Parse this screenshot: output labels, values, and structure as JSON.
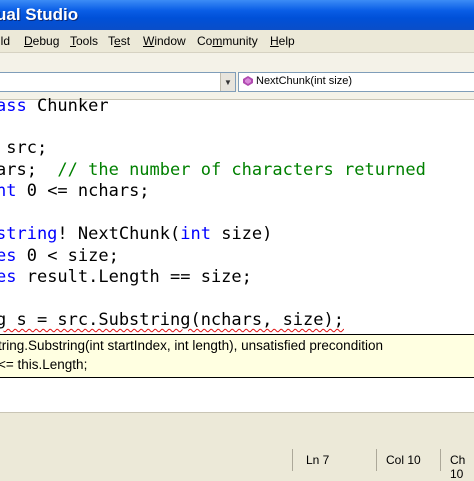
{
  "window": {
    "title": "ual Studio"
  },
  "menu": {
    "items": [
      {
        "pre": "",
        "u": "",
        "post": "ild"
      },
      {
        "pre": "",
        "u": "D",
        "post": "ebug"
      },
      {
        "pre": "",
        "u": "T",
        "post": "ools"
      },
      {
        "pre": "T",
        "u": "e",
        "post": "st"
      },
      {
        "pre": "",
        "u": "W",
        "post": "indow"
      },
      {
        "pre": "Co",
        "u": "m",
        "post": "munity"
      },
      {
        "pre": "",
        "u": "H",
        "post": "elp"
      }
    ]
  },
  "toolbar": {
    "member_dropdown": {
      "value": "NextChunk(int size)"
    }
  },
  "code": {
    "line1": {
      "kw": "ass",
      "rest": " Chunker"
    },
    "line2": {
      "text": " src;"
    },
    "line3": {
      "text": "ars;  ",
      "comment": "// the number of characters returned"
    },
    "line4": {
      "kw": "nt",
      "rest": " 0 <= nchars;"
    },
    "line5": {
      "kw1": "string",
      "mid": "! NextChunk(",
      "kw2": "int",
      "rest": " size)"
    },
    "line6": {
      "kw": "es",
      "rest": " 0 < size;"
    },
    "line7": {
      "kw": "es",
      "rest": " result.Length == size;"
    },
    "line8": {
      "text": "g s = src.Substring(nchars, size);"
    }
  },
  "tooltip": {
    "line1": "tring.Substring(int startIndex, int length), unsatisfied precondition",
    "line2": "<= this.Length;"
  },
  "status": {
    "ln": "Ln 7",
    "col": "Col 10",
    "ch": "Ch 10"
  },
  "colors": {
    "keyword": "#0000ff",
    "comment": "#008000",
    "tooltip_bg": "#ffffe1",
    "titlebar": "#0a5ee6"
  }
}
